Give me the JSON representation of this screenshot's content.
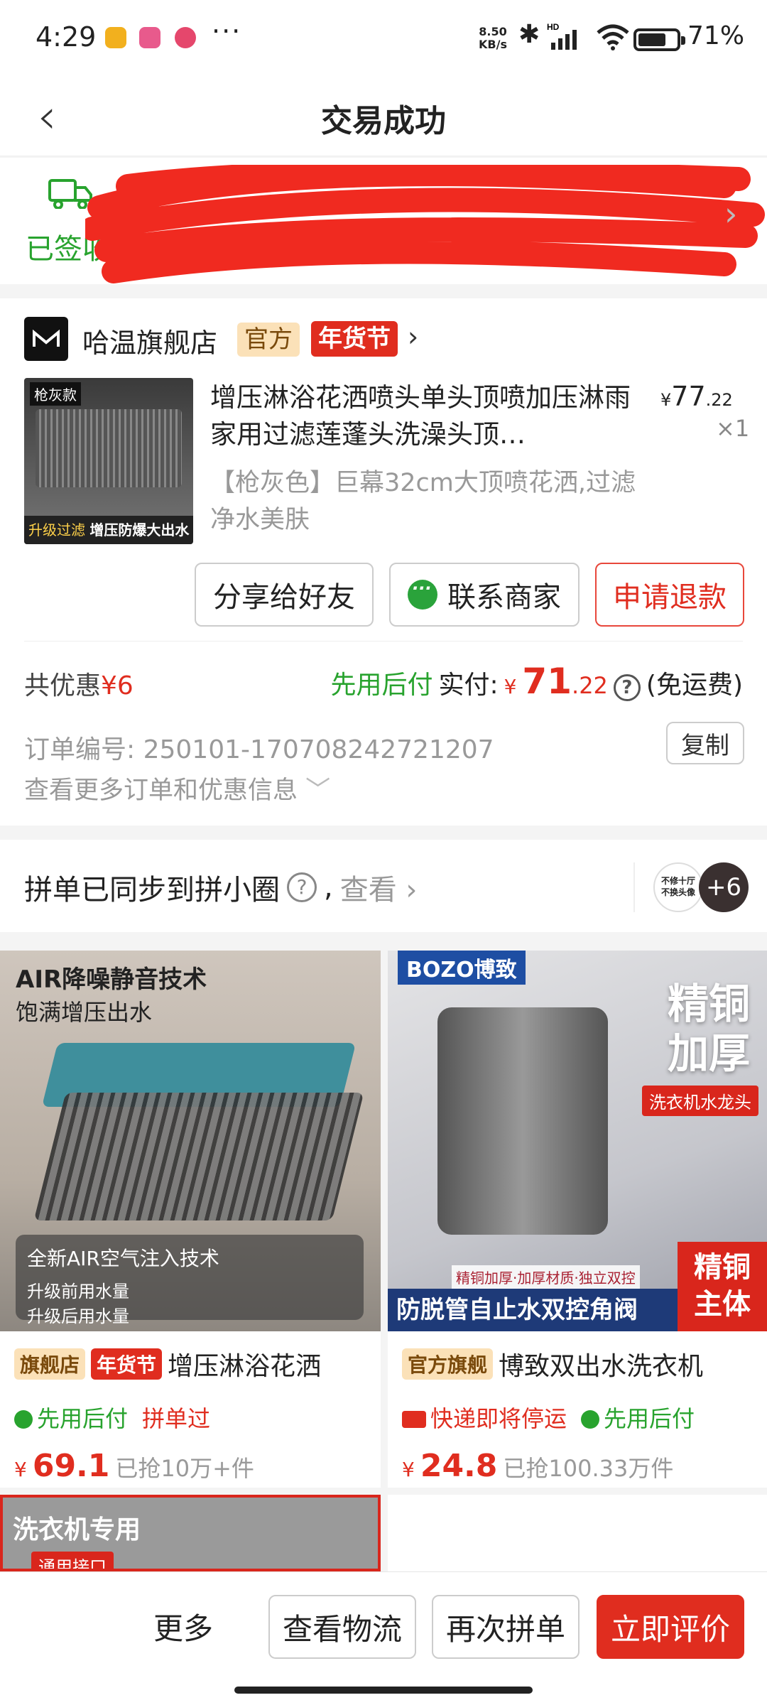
{
  "status_bar": {
    "time": "4:29",
    "net_speed_top": "8.50",
    "net_speed_bottom": "KB/s",
    "network": "HD",
    "battery": "71",
    "more": "···"
  },
  "header": {
    "title": "交易成功"
  },
  "logistics": {
    "status": "已签收"
  },
  "order": {
    "shop_name": "哈温旗舰店",
    "shop_tag_official": "官方",
    "shop_tag_nianhuo": "年货节",
    "product": {
      "title": "增压淋浴花洒喷头单头顶喷加压淋雨家用过滤莲蓬头洗澡头顶…",
      "price_int": "77",
      "price_dec": ".22",
      "currency": "¥",
      "qty": "×1",
      "spec": "【枪灰色】巨幕32cm大顶喷花洒,过滤净水美肤",
      "img_badge": "枪灰款",
      "img_footer_left": "升级过滤",
      "img_footer_right": "增压防爆大出水"
    },
    "buttons": {
      "share": "分享给好友",
      "contact": "联系商家",
      "refund": "申请退款"
    },
    "discount_label": "共优惠",
    "discount_value": "¥6",
    "pay_later": "先用后付",
    "paid_label": "实付:",
    "paid_currency": "¥",
    "paid_int": "71",
    "paid_dec": ".22",
    "shipping": "(免运费)",
    "order_no_label": "订单编号:",
    "order_no": "250101-170708242721207",
    "copy": "复制",
    "more_info": "查看更多订单和优惠信息"
  },
  "group": {
    "text": "拼单已同步到拼小圈",
    "comma": ",",
    "look": "查看",
    "avatar_more": "+6",
    "avatar1_l1": "不修十厅",
    "avatar1_l2": "不换头像"
  },
  "products": [
    {
      "img_headline1": "AIR降噪静音技术",
      "img_headline2": "饱满增压出水",
      "img_panel_title": "全新AIR空气注入技术",
      "img_panel_l1": "升级前用水量",
      "img_panel_l2": "升级后用水量",
      "tag1": "旗舰店",
      "tag2": "年货节",
      "name": "增压淋浴花洒",
      "meta1": "先用后付",
      "meta2": "拼单过",
      "currency": "¥",
      "price": "69.1",
      "sold": "已抢10万+件"
    },
    {
      "img_brand": "BOZO博致",
      "img_big1": "精铜",
      "img_big2": "加厚",
      "img_red": "洗衣机水龙头",
      "img_thin": "精铜加厚·加厚材质·独立双控",
      "img_band": "防脱管自止水双控角阀",
      "img_redblk1": "精铜",
      "img_redblk2": "主体",
      "tag1": "官方旗舰",
      "name": "博致双出水洗衣机",
      "meta1": "快递即将停运",
      "meta2": "先用后付",
      "currency": "¥",
      "price": "24.8",
      "sold": "已抢100.33万件"
    },
    {
      "img_headline1": "洗衣机专用",
      "img_tag": "通用接口"
    }
  ],
  "bottom_bar": {
    "more": "更多",
    "logistics": "查看物流",
    "rebuy": "再次拼单",
    "review": "立即评价"
  },
  "colors": {
    "red": "#e02d1f",
    "green": "#28a32e",
    "tag_bg": "#fbe1b8"
  }
}
